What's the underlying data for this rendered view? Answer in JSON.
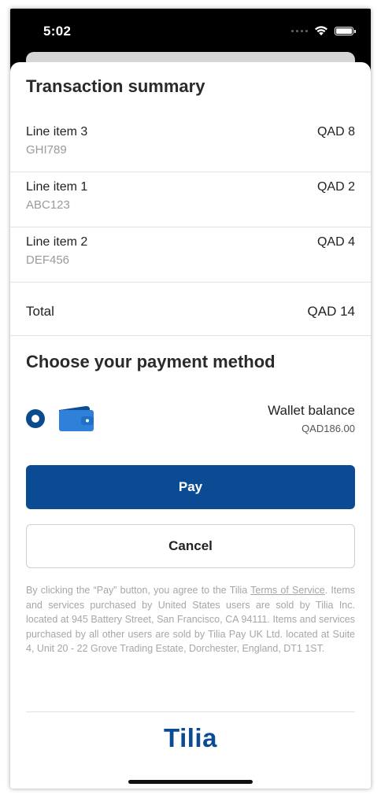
{
  "status_bar": {
    "time": "5:02"
  },
  "summary": {
    "title": "Transaction summary",
    "items": [
      {
        "name": "Line item 3",
        "code": "GHI789",
        "amount": "QAD 8"
      },
      {
        "name": "Line item 1",
        "code": "ABC123",
        "amount": "QAD 2"
      },
      {
        "name": "Line item 2",
        "code": "DEF456",
        "amount": "QAD 4"
      }
    ],
    "total_label": "Total",
    "total_amount": "QAD 14"
  },
  "payment": {
    "title": "Choose your payment method",
    "method_label": "Wallet balance",
    "method_amount": "QAD186.00",
    "method_icon": "wallet-icon",
    "selected": true
  },
  "buttons": {
    "pay": "Pay",
    "cancel": "Cancel"
  },
  "disclaimer": {
    "prefix": "By clicking the “Pay” button, you agree to the Tilia ",
    "link": "Terms of Service",
    "suffix": ". Items and services purchased by United States users are sold by Tilia Inc. located at 945 Battery Street, San Francisco, CA 94111. Items and services purchased by all other users are sold by Tilia Pay UK Ltd. located at Suite 4, Unit 20 - 22 Grove Trading Estate, Dorchester, England, DT1 1ST."
  },
  "brand": {
    "logo": "Tilia",
    "color": "#0a4b93"
  }
}
